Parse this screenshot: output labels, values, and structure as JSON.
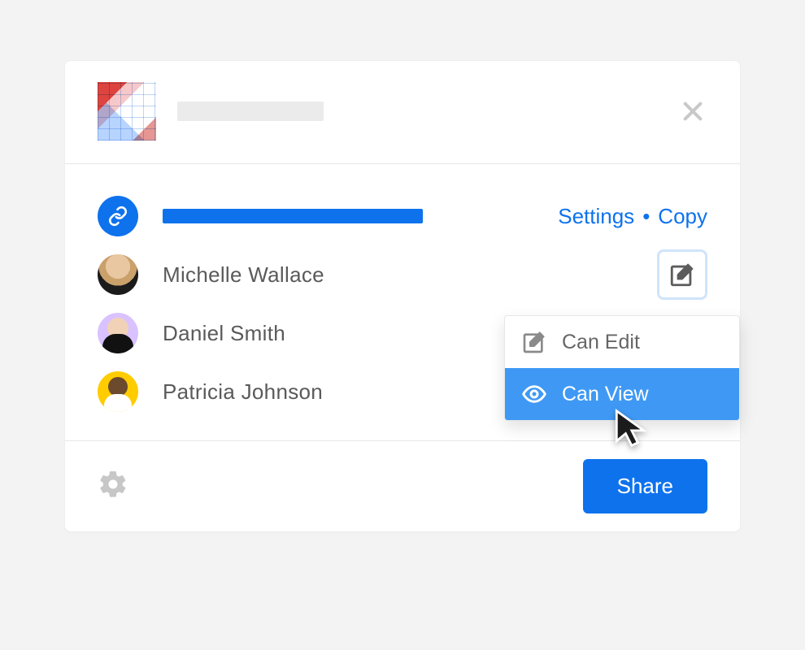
{
  "header": {
    "title_placeholder": true
  },
  "link_row": {
    "settings_label": "Settings",
    "separator": "•",
    "copy_label": "Copy"
  },
  "people": [
    {
      "name": "Michelle Wallace",
      "permission": "edit",
      "highlighted": true
    },
    {
      "name": "Daniel Smith",
      "permission": "view"
    },
    {
      "name": "Patricia Johnson",
      "permission": "view"
    }
  ],
  "dropdown": {
    "items": [
      {
        "label": "Can Edit",
        "value": "edit"
      },
      {
        "label": "Can View",
        "value": "view"
      }
    ],
    "selected": "view"
  },
  "footer": {
    "share_label": "Share"
  },
  "colors": {
    "accent": "#0e72ed",
    "highlight": "#3f99f4"
  }
}
